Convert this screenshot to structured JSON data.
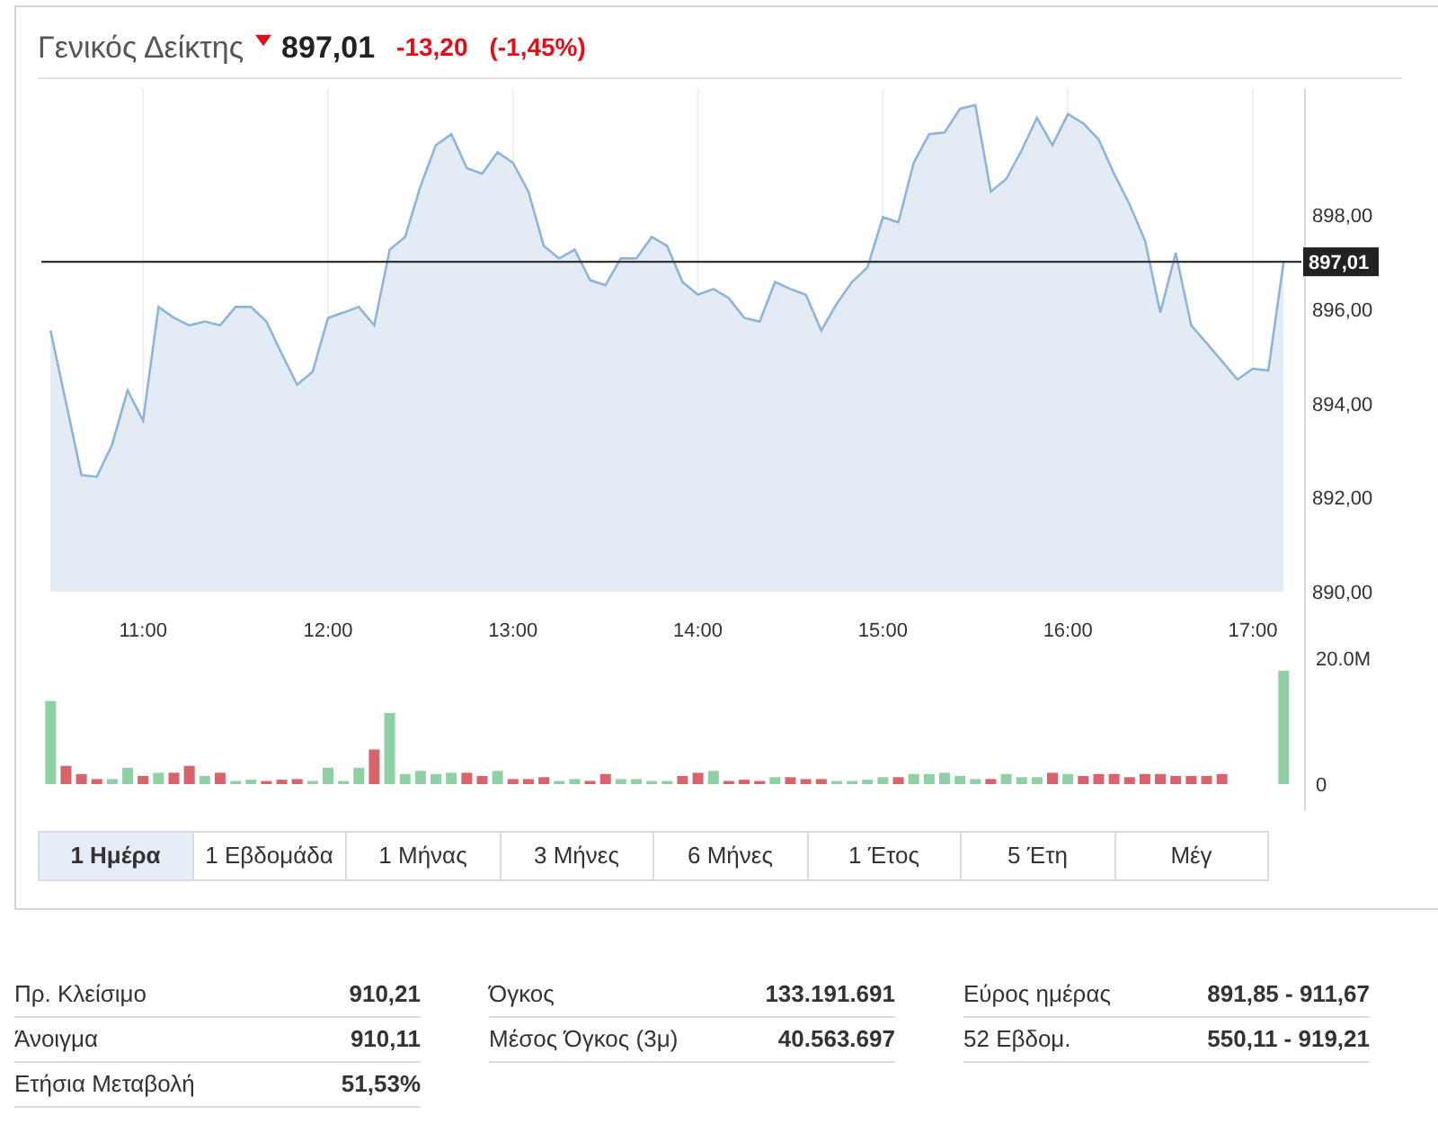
{
  "header": {
    "title": "Γενικός Δείκτης",
    "falling": true,
    "price": "897,01",
    "change": "-13,20",
    "change_percent": "(-1,45%)"
  },
  "price_chart": {
    "chart_data": {
      "type": "area",
      "x": [
        630,
        635,
        640,
        645,
        650,
        655,
        660,
        665,
        670,
        675,
        680,
        685,
        690,
        695,
        700,
        705,
        710,
        715,
        720,
        725,
        730,
        735,
        740,
        745,
        750,
        755,
        760,
        765,
        770,
        775,
        780,
        785,
        790,
        795,
        800,
        805,
        810,
        815,
        820,
        825,
        830,
        835,
        840,
        845,
        850,
        855,
        860,
        865,
        870,
        875,
        880,
        885,
        890,
        895,
        900,
        905,
        910,
        915,
        920,
        925,
        930,
        935,
        940,
        945,
        950,
        955,
        960,
        965,
        970,
        975,
        980,
        985,
        990,
        995,
        1000,
        1005,
        1010,
        1015,
        1020,
        1025,
        1030
      ],
      "series": [
        {
          "color": "#8fb4d9",
          "values": [
            895.55,
            894.02,
            892.48,
            892.44,
            893.13,
            894.28,
            893.63,
            896.05,
            895.82,
            895.66,
            895.74,
            895.66,
            896.05,
            896.05,
            895.74,
            895.05,
            894.4,
            894.67,
            895.82,
            895.93,
            896.05,
            895.66,
            897.27,
            897.54,
            898.61,
            899.49,
            899.72,
            899.0,
            898.88,
            899.34,
            899.11,
            898.5,
            897.35,
            897.08,
            897.27,
            896.62,
            896.51,
            897.08,
            897.08,
            897.54,
            897.35,
            896.58,
            896.31,
            896.43,
            896.24,
            895.82,
            895.74,
            896.58,
            896.43,
            896.31,
            895.55,
            896.12,
            896.58,
            896.89,
            897.96,
            897.85,
            899.11,
            899.72,
            899.76,
            900.26,
            900.34,
            898.5,
            898.77,
            899.38,
            900.07,
            899.49,
            900.15,
            899.95,
            899.61,
            898.88,
            898.23,
            897.46,
            895.93,
            897.2,
            895.66,
            895.28,
            894.9,
            894.51,
            894.74,
            894.7,
            897.01
          ]
        }
      ],
      "xlim": [
        627,
        1034
      ],
      "ylim": [
        890,
        900.7
      ],
      "xticks": [
        {
          "value": 660,
          "label": "11:00"
        },
        {
          "value": 720,
          "label": "12:00"
        },
        {
          "value": 780,
          "label": "13:00"
        },
        {
          "value": 840,
          "label": "14:00"
        },
        {
          "value": 900,
          "label": "15:00"
        },
        {
          "value": 960,
          "label": "16:00"
        },
        {
          "value": 1020,
          "label": "17:00"
        }
      ],
      "yticks": [
        {
          "value": 890,
          "label": "890,00"
        },
        {
          "value": 892,
          "label": "892,00"
        },
        {
          "value": 894,
          "label": "894,00"
        },
        {
          "value": 896,
          "label": "896,00"
        },
        {
          "value": 898,
          "label": "898,00"
        }
      ],
      "grid": true,
      "ref_lines": [
        {
          "axis": "y",
          "value": 897.01,
          "label": "897,01"
        }
      ]
    }
  },
  "volume_chart": {
    "chart_data": {
      "type": "bar",
      "x": [
        630,
        635,
        640,
        645,
        650,
        655,
        660,
        665,
        670,
        675,
        680,
        685,
        690,
        695,
        700,
        705,
        710,
        715,
        720,
        725,
        730,
        735,
        740,
        745,
        750,
        755,
        760,
        765,
        770,
        775,
        780,
        785,
        790,
        795,
        800,
        805,
        810,
        815,
        820,
        825,
        830,
        835,
        840,
        845,
        850,
        855,
        860,
        865,
        870,
        875,
        880,
        885,
        890,
        895,
        900,
        905,
        910,
        915,
        920,
        925,
        930,
        935,
        940,
        945,
        950,
        955,
        960,
        965,
        970,
        975,
        980,
        985,
        990,
        995,
        1000,
        1005,
        1010,
        1030
      ],
      "series": [
        {
          "color": "#8fd1a5",
          "values": [
            13.2,
            null,
            null,
            null,
            0.8,
            2.6,
            null,
            1.8,
            null,
            null,
            1.3,
            null,
            0.5,
            0.7,
            null,
            null,
            null,
            0.5,
            2.6,
            0.5,
            2.6,
            null,
            11.3,
            1.6,
            2.1,
            1.6,
            1.8,
            null,
            null,
            2.1,
            null,
            null,
            null,
            0.5,
            0.8,
            null,
            null,
            0.8,
            0.8,
            0.5,
            0.5,
            null,
            null,
            2.1,
            null,
            null,
            null,
            1.1,
            null,
            null,
            null,
            0.5,
            0.5,
            0.7,
            1.1,
            null,
            1.6,
            1.6,
            1.8,
            1.3,
            0.8,
            null,
            1.6,
            1.1,
            1.1,
            null,
            1.6,
            null,
            null,
            null,
            null,
            null,
            null,
            null,
            null,
            null,
            null,
            18.0
          ]
        },
        {
          "color": "#d9636b",
          "values": [
            null,
            2.9,
            1.6,
            0.8,
            null,
            null,
            1.3,
            null,
            1.8,
            2.9,
            null,
            1.8,
            null,
            null,
            0.5,
            0.7,
            0.8,
            null,
            null,
            null,
            null,
            5.5,
            null,
            null,
            null,
            null,
            null,
            1.8,
            1.3,
            null,
            0.8,
            0.8,
            1.1,
            null,
            null,
            0.5,
            1.6,
            null,
            null,
            null,
            null,
            1.3,
            1.8,
            null,
            0.5,
            0.7,
            0.5,
            null,
            1.1,
            0.8,
            0.8,
            null,
            null,
            null,
            null,
            1.1,
            null,
            null,
            null,
            null,
            null,
            0.8,
            null,
            null,
            null,
            1.8,
            null,
            1.3,
            1.6,
            1.6,
            1.1,
            1.6,
            1.6,
            1.3,
            1.3,
            1.3,
            1.6,
            null
          ]
        }
      ],
      "xlim": [
        627,
        1034
      ],
      "ylim": [
        0,
        20
      ],
      "yticks": [
        {
          "value": 0,
          "label": "0"
        },
        {
          "value": 20,
          "label": "20.0M"
        }
      ]
    }
  },
  "ranges": [
    {
      "label": "1 Ημέρα",
      "selected": true
    },
    {
      "label": "1 Εβδομάδα",
      "selected": false
    },
    {
      "label": "1 Μήνας",
      "selected": false
    },
    {
      "label": "3 Μήνες",
      "selected": false
    },
    {
      "label": "6 Μήνες",
      "selected": false
    },
    {
      "label": "1 Έτος",
      "selected": false
    },
    {
      "label": "5 Έτη",
      "selected": false
    },
    {
      "label": "Μέγ",
      "selected": false
    }
  ],
  "stats": [
    [
      {
        "label": "Πρ. Κλείσιμο",
        "value": "910,21"
      },
      {
        "label": "Άνοιγμα",
        "value": "910,11"
      },
      {
        "label": "Ετήσια Μεταβολή",
        "value": "51,53%"
      }
    ],
    [
      {
        "label": "Όγκος",
        "value": "133.191.691"
      },
      {
        "label": "Μέσος Όγκος (3μ)",
        "value": "40.563.697"
      }
    ],
    [
      {
        "label": "Εύρος ημέρας",
        "value": "891,85 - 911,67"
      },
      {
        "label": "52 Εβδομ.",
        "value": "550,11 - 919,21"
      }
    ]
  ]
}
